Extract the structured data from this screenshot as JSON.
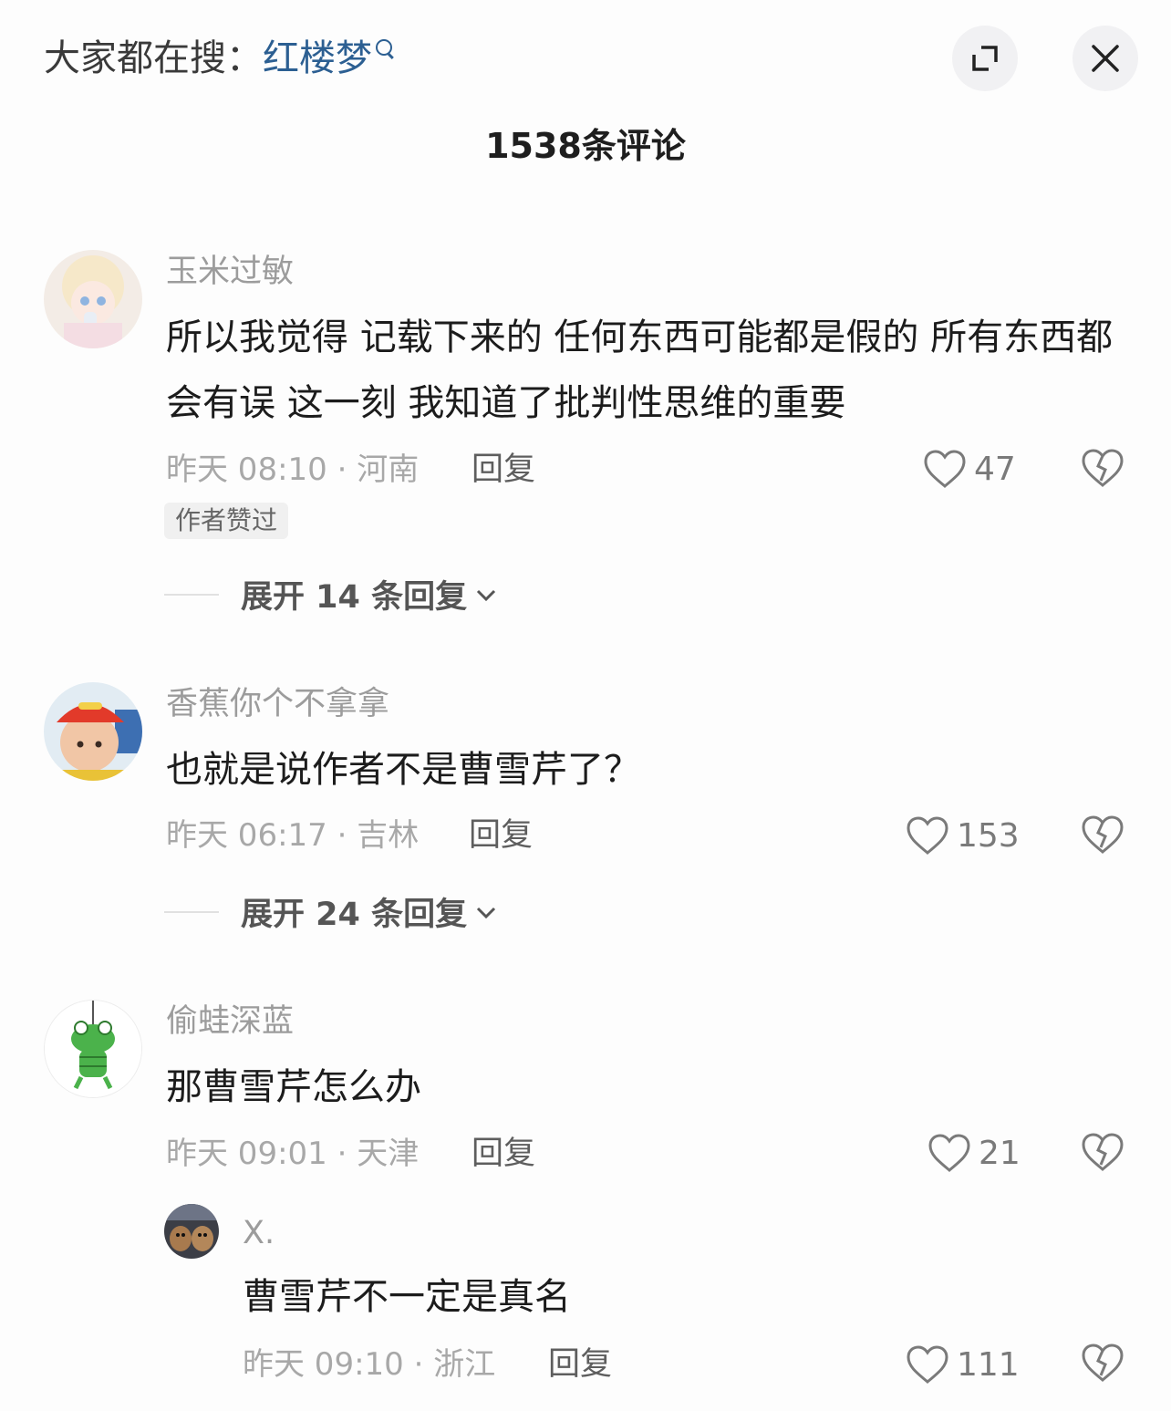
{
  "header": {
    "search_prefix": "大家都在搜：",
    "search_keyword": "红楼梦",
    "comment_count_title": "1538条评论"
  },
  "comments": [
    {
      "username": "玉米过敏",
      "text": "所以我觉得 记载下来的 任何东西可能都是假的 所有东西都会有误 这一刻 我知道了批判性思维的重要",
      "meta": "昨天 08:10 · 河南",
      "reply_label": "回复",
      "likes": "47",
      "badge": "作者赞过",
      "expand_label": "展开 14 条回复"
    },
    {
      "username": "香蕉你个不拿拿",
      "text": "也就是说作者不是曹雪芹了？",
      "meta": "昨天 06:17 · 吉林",
      "reply_label": "回复",
      "likes": "153",
      "expand_label": "展开 24 条回复"
    },
    {
      "username": "偷蛙深蓝",
      "text": "那曹雪芹怎么办",
      "meta": "昨天 09:01 · 天津",
      "reply_label": "回复",
      "likes": "21",
      "replies": [
        {
          "username": "X.",
          "text": "曹雪芹不一定是真名",
          "meta": "昨天 09:10 · 浙江",
          "reply_label": "回复",
          "likes": "111"
        }
      ]
    }
  ],
  "colors": {
    "keyword": "#2c5f92",
    "background": "#fdfdfd",
    "muted": "#a8a8a8"
  },
  "icons": [
    "search-icon",
    "expand-icon",
    "close-icon",
    "heart-icon",
    "broken-heart-icon",
    "chevron-down-icon"
  ]
}
